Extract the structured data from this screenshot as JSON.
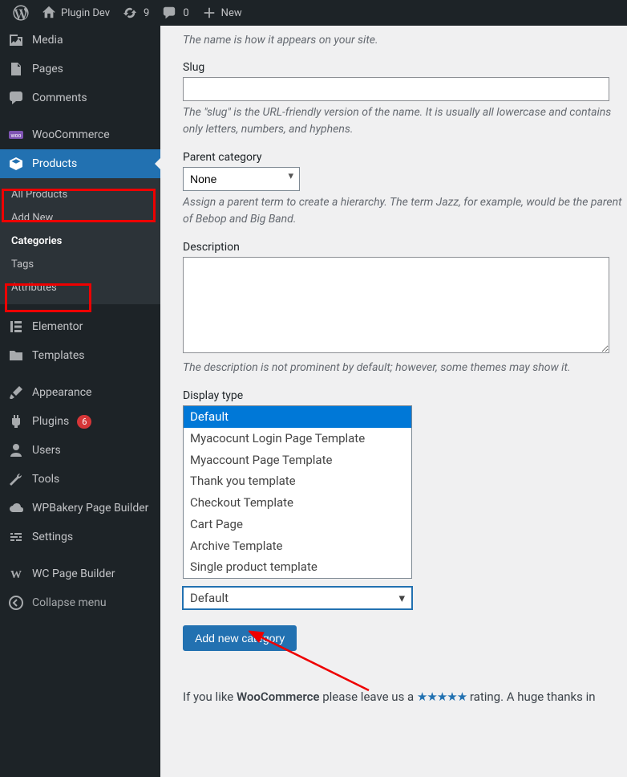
{
  "adminbar": {
    "site_name": "Plugin Dev",
    "updates_count": "9",
    "comments_count": "0",
    "new_label": "New"
  },
  "sidebar": {
    "items": [
      {
        "label": "Media"
      },
      {
        "label": "Pages"
      },
      {
        "label": "Comments"
      },
      {
        "label": "WooCommerce"
      },
      {
        "label": "Products"
      },
      {
        "label": "Elementor"
      },
      {
        "label": "Templates"
      },
      {
        "label": "Appearance"
      },
      {
        "label": "Plugins",
        "badge": "6"
      },
      {
        "label": "Users"
      },
      {
        "label": "Tools"
      },
      {
        "label": "WPBakery Page Builder"
      },
      {
        "label": "Settings"
      },
      {
        "label": "WC Page Builder"
      }
    ],
    "collapse_label": "Collapse menu",
    "products_submenu": [
      {
        "label": "All Products"
      },
      {
        "label": "Add New"
      },
      {
        "label": "Categories"
      },
      {
        "label": "Tags"
      },
      {
        "label": "Attributes"
      }
    ]
  },
  "form": {
    "name_help": "The name is how it appears on your site.",
    "slug_label": "Slug",
    "slug_value": "",
    "slug_help": "The \"slug\" is the URL-friendly version of the name. It is usually all lowercase and contains only letters, numbers, and hyphens.",
    "parent_label": "Parent category",
    "parent_value": "None",
    "parent_help": "Assign a parent term to create a hierarchy. The term Jazz, for example, would be the parent of Bebop and Big Band.",
    "desc_label": "Description",
    "desc_value": "",
    "desc_help": "The description is not prominent by default; however, some themes may show it.",
    "display_label": "Display type",
    "display_options": [
      "Default",
      "Myacocunt Login Page Template",
      "Myaccount Page Template",
      "Thank you template",
      "Checkout Template",
      "Cart Page",
      "Archive Template",
      "Single product template"
    ],
    "display_selected": "Default",
    "submit_label": "Add new category"
  },
  "footer": {
    "prefix": "If you like ",
    "brand": "WooCommerce",
    "mid": " please leave us a ",
    "stars": "★★★★★",
    "suffix": " rating. A huge thanks in"
  }
}
